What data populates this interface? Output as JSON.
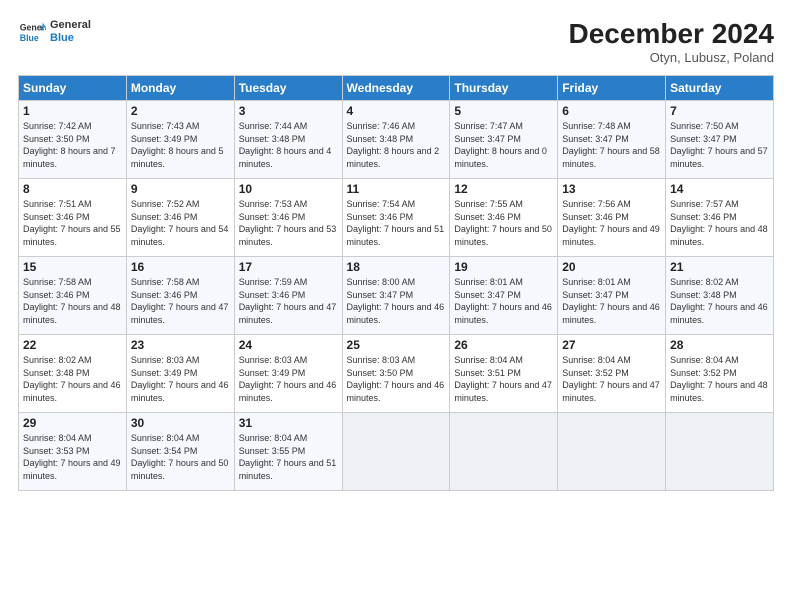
{
  "logo": {
    "line1": "General",
    "line2": "Blue"
  },
  "title": "December 2024",
  "location": "Otyn, Lubusz, Poland",
  "days_header": [
    "Sunday",
    "Monday",
    "Tuesday",
    "Wednesday",
    "Thursday",
    "Friday",
    "Saturday"
  ],
  "weeks": [
    [
      {
        "day": "1",
        "sunrise": "Sunrise: 7:42 AM",
        "sunset": "Sunset: 3:50 PM",
        "daylight": "Daylight: 8 hours and 7 minutes."
      },
      {
        "day": "2",
        "sunrise": "Sunrise: 7:43 AM",
        "sunset": "Sunset: 3:49 PM",
        "daylight": "Daylight: 8 hours and 5 minutes."
      },
      {
        "day": "3",
        "sunrise": "Sunrise: 7:44 AM",
        "sunset": "Sunset: 3:48 PM",
        "daylight": "Daylight: 8 hours and 4 minutes."
      },
      {
        "day": "4",
        "sunrise": "Sunrise: 7:46 AM",
        "sunset": "Sunset: 3:48 PM",
        "daylight": "Daylight: 8 hours and 2 minutes."
      },
      {
        "day": "5",
        "sunrise": "Sunrise: 7:47 AM",
        "sunset": "Sunset: 3:47 PM",
        "daylight": "Daylight: 8 hours and 0 minutes."
      },
      {
        "day": "6",
        "sunrise": "Sunrise: 7:48 AM",
        "sunset": "Sunset: 3:47 PM",
        "daylight": "Daylight: 7 hours and 58 minutes."
      },
      {
        "day": "7",
        "sunrise": "Sunrise: 7:50 AM",
        "sunset": "Sunset: 3:47 PM",
        "daylight": "Daylight: 7 hours and 57 minutes."
      }
    ],
    [
      {
        "day": "8",
        "sunrise": "Sunrise: 7:51 AM",
        "sunset": "Sunset: 3:46 PM",
        "daylight": "Daylight: 7 hours and 55 minutes."
      },
      {
        "day": "9",
        "sunrise": "Sunrise: 7:52 AM",
        "sunset": "Sunset: 3:46 PM",
        "daylight": "Daylight: 7 hours and 54 minutes."
      },
      {
        "day": "10",
        "sunrise": "Sunrise: 7:53 AM",
        "sunset": "Sunset: 3:46 PM",
        "daylight": "Daylight: 7 hours and 53 minutes."
      },
      {
        "day": "11",
        "sunrise": "Sunrise: 7:54 AM",
        "sunset": "Sunset: 3:46 PM",
        "daylight": "Daylight: 7 hours and 51 minutes."
      },
      {
        "day": "12",
        "sunrise": "Sunrise: 7:55 AM",
        "sunset": "Sunset: 3:46 PM",
        "daylight": "Daylight: 7 hours and 50 minutes."
      },
      {
        "day": "13",
        "sunrise": "Sunrise: 7:56 AM",
        "sunset": "Sunset: 3:46 PM",
        "daylight": "Daylight: 7 hours and 49 minutes."
      },
      {
        "day": "14",
        "sunrise": "Sunrise: 7:57 AM",
        "sunset": "Sunset: 3:46 PM",
        "daylight": "Daylight: 7 hours and 48 minutes."
      }
    ],
    [
      {
        "day": "15",
        "sunrise": "Sunrise: 7:58 AM",
        "sunset": "Sunset: 3:46 PM",
        "daylight": "Daylight: 7 hours and 48 minutes."
      },
      {
        "day": "16",
        "sunrise": "Sunrise: 7:58 AM",
        "sunset": "Sunset: 3:46 PM",
        "daylight": "Daylight: 7 hours and 47 minutes."
      },
      {
        "day": "17",
        "sunrise": "Sunrise: 7:59 AM",
        "sunset": "Sunset: 3:46 PM",
        "daylight": "Daylight: 7 hours and 47 minutes."
      },
      {
        "day": "18",
        "sunrise": "Sunrise: 8:00 AM",
        "sunset": "Sunset: 3:47 PM",
        "daylight": "Daylight: 7 hours and 46 minutes."
      },
      {
        "day": "19",
        "sunrise": "Sunrise: 8:01 AM",
        "sunset": "Sunset: 3:47 PM",
        "daylight": "Daylight: 7 hours and 46 minutes."
      },
      {
        "day": "20",
        "sunrise": "Sunrise: 8:01 AM",
        "sunset": "Sunset: 3:47 PM",
        "daylight": "Daylight: 7 hours and 46 minutes."
      },
      {
        "day": "21",
        "sunrise": "Sunrise: 8:02 AM",
        "sunset": "Sunset: 3:48 PM",
        "daylight": "Daylight: 7 hours and 46 minutes."
      }
    ],
    [
      {
        "day": "22",
        "sunrise": "Sunrise: 8:02 AM",
        "sunset": "Sunset: 3:48 PM",
        "daylight": "Daylight: 7 hours and 46 minutes."
      },
      {
        "day": "23",
        "sunrise": "Sunrise: 8:03 AM",
        "sunset": "Sunset: 3:49 PM",
        "daylight": "Daylight: 7 hours and 46 minutes."
      },
      {
        "day": "24",
        "sunrise": "Sunrise: 8:03 AM",
        "sunset": "Sunset: 3:49 PM",
        "daylight": "Daylight: 7 hours and 46 minutes."
      },
      {
        "day": "25",
        "sunrise": "Sunrise: 8:03 AM",
        "sunset": "Sunset: 3:50 PM",
        "daylight": "Daylight: 7 hours and 46 minutes."
      },
      {
        "day": "26",
        "sunrise": "Sunrise: 8:04 AM",
        "sunset": "Sunset: 3:51 PM",
        "daylight": "Daylight: 7 hours and 47 minutes."
      },
      {
        "day": "27",
        "sunrise": "Sunrise: 8:04 AM",
        "sunset": "Sunset: 3:52 PM",
        "daylight": "Daylight: 7 hours and 47 minutes."
      },
      {
        "day": "28",
        "sunrise": "Sunrise: 8:04 AM",
        "sunset": "Sunset: 3:52 PM",
        "daylight": "Daylight: 7 hours and 48 minutes."
      }
    ],
    [
      {
        "day": "29",
        "sunrise": "Sunrise: 8:04 AM",
        "sunset": "Sunset: 3:53 PM",
        "daylight": "Daylight: 7 hours and 49 minutes."
      },
      {
        "day": "30",
        "sunrise": "Sunrise: 8:04 AM",
        "sunset": "Sunset: 3:54 PM",
        "daylight": "Daylight: 7 hours and 50 minutes."
      },
      {
        "day": "31",
        "sunrise": "Sunrise: 8:04 AM",
        "sunset": "Sunset: 3:55 PM",
        "daylight": "Daylight: 7 hours and 51 minutes."
      },
      null,
      null,
      null,
      null
    ]
  ]
}
